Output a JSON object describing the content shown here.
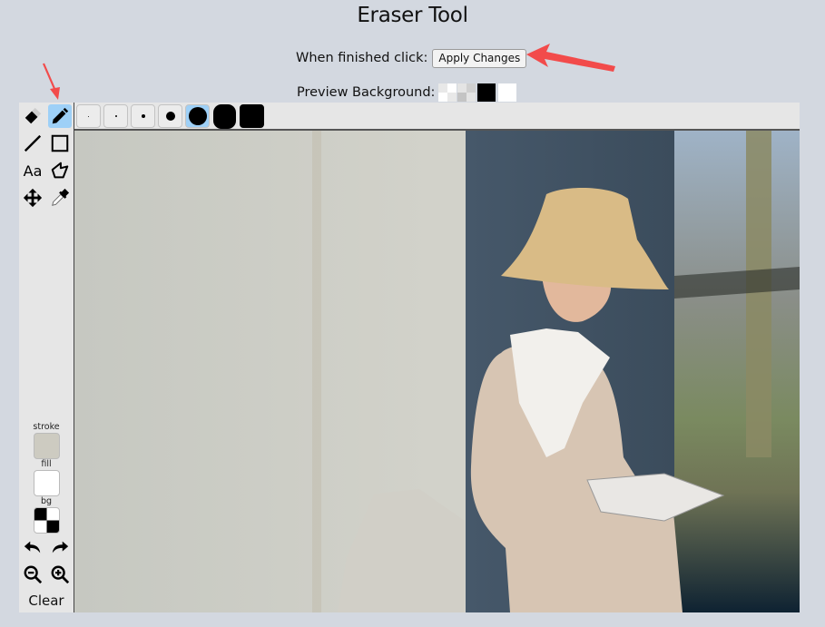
{
  "page": {
    "title": "Eraser Tool",
    "finish_label": "When finished click:",
    "apply_button": "Apply Changes",
    "preview_label": "Preview Background:",
    "preview_swatches": [
      "checker-light",
      "checker-gray",
      "black",
      "white"
    ]
  },
  "toolbar": {
    "tools": [
      {
        "name": "eraser",
        "icon": "eraser-icon",
        "active": false
      },
      {
        "name": "pencil",
        "icon": "pencil-icon",
        "active": true
      },
      {
        "name": "line",
        "icon": "line-icon",
        "active": false
      },
      {
        "name": "rectangle",
        "icon": "rectangle-icon",
        "active": false
      },
      {
        "name": "text",
        "icon": "text-icon",
        "label": "Aa",
        "active": false
      },
      {
        "name": "polygon",
        "icon": "polygon-icon",
        "active": false
      },
      {
        "name": "move",
        "icon": "move-icon",
        "active": false
      },
      {
        "name": "eyedropper",
        "icon": "eyedropper-icon",
        "active": false
      }
    ],
    "stroke_label": "stroke",
    "fill_label": "fill",
    "bg_label": "bg",
    "stroke_color": "#cdcbc1",
    "fill_color": "#ffffff",
    "undo_icon": "undo-icon",
    "redo_icon": "redo-icon",
    "zoom_out_icon": "zoom-out-icon",
    "zoom_in_icon": "zoom-in-icon",
    "clear_label": "Clear"
  },
  "brush_sizes": {
    "options": [
      "1",
      "2",
      "3",
      "5",
      "8",
      "12",
      "16"
    ],
    "selected_index": 4
  },
  "colors": {
    "active_highlight": "#9ed0f7",
    "annotation_arrow": "#f24b4b",
    "page_background": "#d3d8e0",
    "panel_background": "#e6e6e6"
  }
}
